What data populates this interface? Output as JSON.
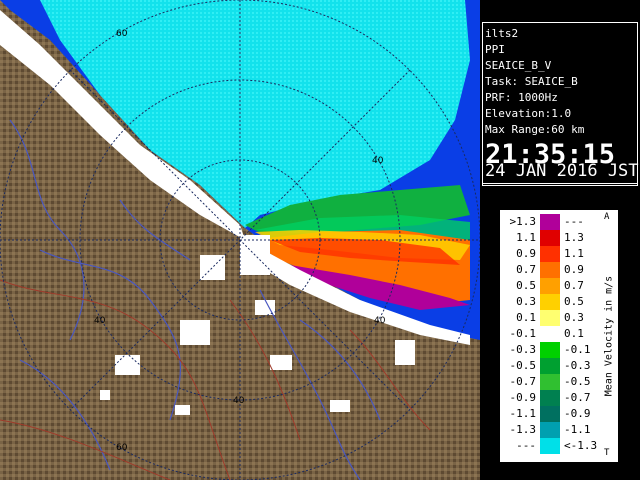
{
  "info": {
    "lines": [
      "ilts2",
      "PPI",
      "SEAICE_B_V",
      "Task: SEAICE_B",
      "PRF: 1000Hz",
      "Elevation:1.0",
      "Max Range:60 km"
    ],
    "time": "21:35:15",
    "date": "24 JAN 2016 JST"
  },
  "range_labels": [
    "60",
    "40",
    "40",
    "40",
    "40",
    "60"
  ],
  "legend": {
    "title": "Mean Velocity in m/s",
    "arrow_top": "A",
    "arrow_bottom": "T",
    "rows": [
      {
        "left": ">1.3",
        "right": "---",
        "color": "#b0009a"
      },
      {
        "left": "1.1",
        "right": "1.3",
        "color": "#e00000"
      },
      {
        "left": "0.9",
        "right": "1.1",
        "color": "#ff3000"
      },
      {
        "left": "0.7",
        "right": "0.9",
        "color": "#ff7000"
      },
      {
        "left": "0.5",
        "right": "0.7",
        "color": "#ffa000"
      },
      {
        "left": "0.3",
        "right": "0.5",
        "color": "#ffd000"
      },
      {
        "left": "0.1",
        "right": "0.3",
        "color": "#ffff70"
      },
      {
        "left": "-0.1",
        "right": "0.1",
        "color": "#ffffff"
      },
      {
        "left": "-0.3",
        "right": "-0.1",
        "color": "#00d000"
      },
      {
        "left": "-0.5",
        "right": "-0.3",
        "color": "#00a030"
      },
      {
        "left": "-0.7",
        "right": "-0.5",
        "color": "#30c030"
      },
      {
        "left": "-0.9",
        "right": "-0.7",
        "color": "#008050"
      },
      {
        "left": "-1.1",
        "right": "-0.9",
        "color": "#007060"
      },
      {
        "left": "-1.3",
        "right": "-1.1",
        "color": "#00a0b0"
      },
      {
        "left": "---",
        "right": "<-1.3",
        "color": "#00e0e8"
      }
    ]
  },
  "colors": {
    "land": "#7a6446",
    "sea_echo": "#10e4ee",
    "ocean": "#0a3ee6",
    "snow": "#ffffff"
  }
}
